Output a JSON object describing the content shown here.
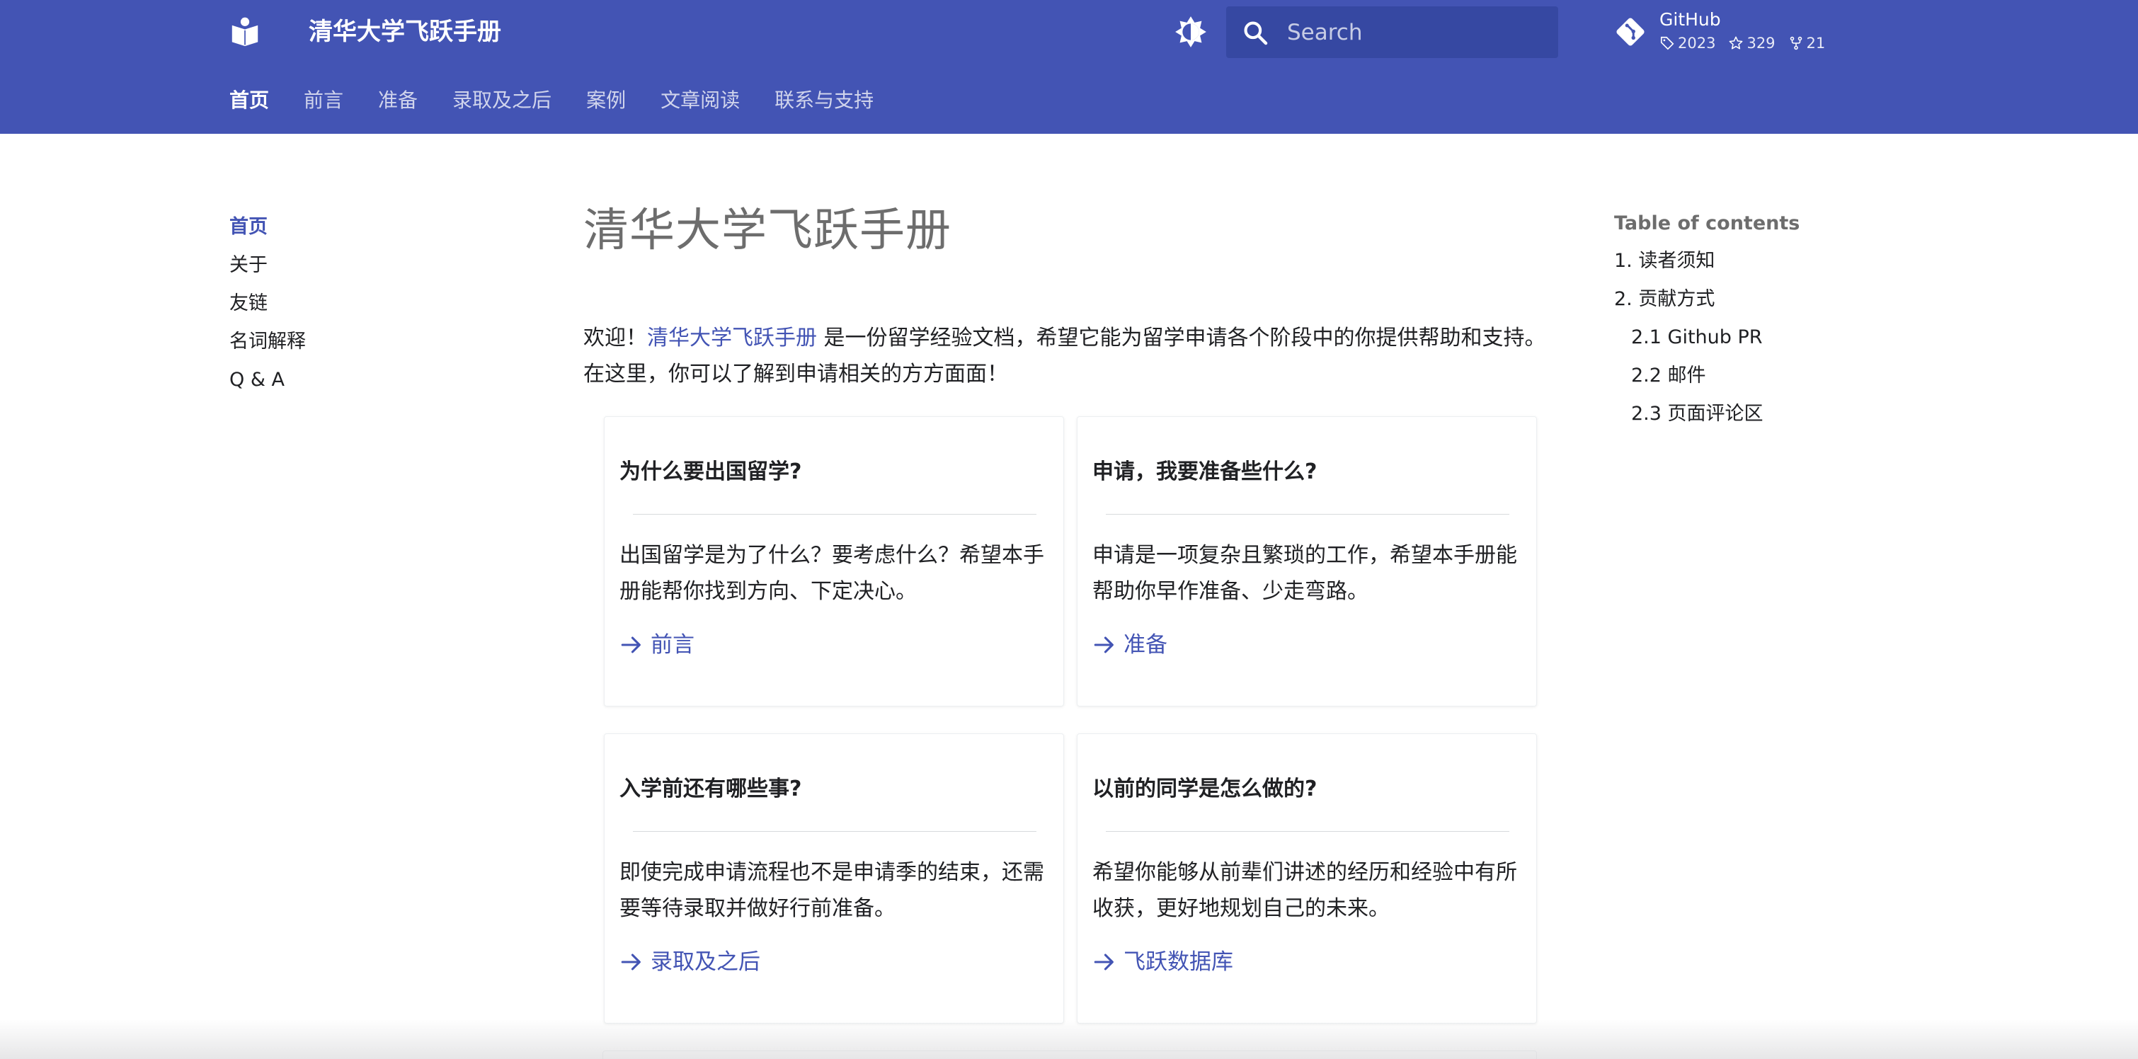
{
  "header": {
    "site_title": "清华大学飞跃手册",
    "search_placeholder": "Search",
    "repo": {
      "name": "GitHub",
      "version": "2023",
      "stars": "329",
      "forks": "21"
    },
    "tabs": [
      {
        "label": "首页",
        "active": true
      },
      {
        "label": "前言"
      },
      {
        "label": "准备"
      },
      {
        "label": "录取及之后"
      },
      {
        "label": "案例"
      },
      {
        "label": "文章阅读"
      },
      {
        "label": "联系与支持"
      }
    ],
    "colors": {
      "primary": "#4354b4",
      "search_bg": "#3648a2"
    }
  },
  "sidebar": {
    "items": [
      {
        "label": "首页",
        "active": true
      },
      {
        "label": "关于"
      },
      {
        "label": "友链"
      },
      {
        "label": "名词解释"
      },
      {
        "label": "Q & A"
      }
    ]
  },
  "main": {
    "title": "清华大学飞跃手册",
    "intro": {
      "prefix": "欢迎！",
      "link": "清华大学飞跃手册",
      "suffix": " 是一份留学经验文档，希望它能为留学申请各个阶段中的你提供帮助和支持。在这里，你可以了解到申请相关的方方面面！"
    },
    "cards": [
      {
        "title": "为什么要出国留学?",
        "text": "出国留学是为了什么？要考虑什么？希望本手册能帮你找到方向、下定决心。",
        "link": "前言"
      },
      {
        "title": "申请，我要准备些什么?",
        "text": "申请是一项复杂且繁琐的工作，希望本手册能帮助你早作准备、少走弯路。",
        "link": "准备"
      },
      {
        "title": "入学前还有哪些事?",
        "text": "即使完成申请流程也不是申请季的结束，还需要等待录取并做好行前准备。",
        "link": "录取及之后"
      },
      {
        "title": "以前的同学是怎么做的?",
        "text": "希望你能够从前辈们讲述的经历和经验中有所收获，更好地规划自己的未来。",
        "link": "飞跃数据库"
      }
    ]
  },
  "toc": {
    "title": "Table of contents",
    "entries": [
      {
        "label": "1. 读者须知"
      },
      {
        "label": "2. 贡献方式"
      },
      {
        "label": "2.1 Github PR",
        "sub": true
      },
      {
        "label": "2.2 邮件",
        "sub": true
      },
      {
        "label": "2.3 页面评论区",
        "sub": true
      }
    ]
  }
}
